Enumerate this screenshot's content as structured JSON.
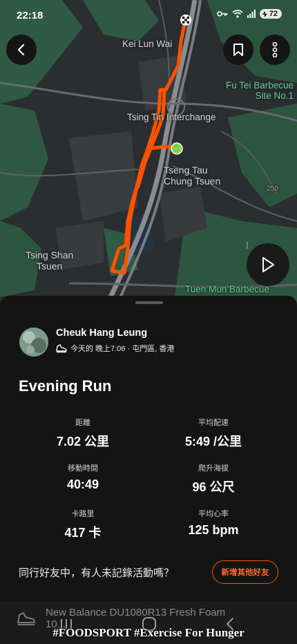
{
  "status_bar": {
    "time": "22:18",
    "battery": "72"
  },
  "map": {
    "labels": {
      "kei_lun_wai": "Kei Lun Wai",
      "fu_tei": "Fu Tei Barbecue\nSite No.1",
      "fu_tei_line1": "Fu Tei Barbecue",
      "fu_tei_line2": "Site No.1",
      "tsing_tin": "Tsing Tin Interchange",
      "tseng_tau_line1": "Tseng Tau",
      "tseng_tau_line2": "Chung Tsuen",
      "tsing_shan_line1": "Tsing Shan",
      "tsing_shan_line2": "Tsuen",
      "tuen_mun": "Tuen Mun Barbecue",
      "elev": "250"
    },
    "route_color": "#fc5200",
    "start_color": "#7fd14a"
  },
  "athlete": {
    "name": "Cheuk Hang Leung",
    "meta": "今天的 晚上7:06 · 屯門區, 香港"
  },
  "activity": {
    "title": "Evening Run",
    "stats": [
      {
        "label": "距離",
        "value": "7.02 公里"
      },
      {
        "label": "平均配速",
        "value": "5:49 /公里"
      },
      {
        "label": "移動時間",
        "value": "40:49"
      },
      {
        "label": "爬升海拔",
        "value": "96 公尺"
      },
      {
        "label": "卡路里",
        "value": "417 卡"
      },
      {
        "label": "平均心率",
        "value": "125 bpm"
      }
    ]
  },
  "friends": {
    "question": "同行好友中，有人未記錄活動嗎？",
    "button": "新增其他好友"
  },
  "gear": {
    "text": "New Balance DU1080R13 Fresh Foam",
    "text2": "10..."
  },
  "watermark": "#FOODSPORT #Exercise For Hunger",
  "colors": {
    "accent": "#fc5200",
    "background": "#141414"
  }
}
